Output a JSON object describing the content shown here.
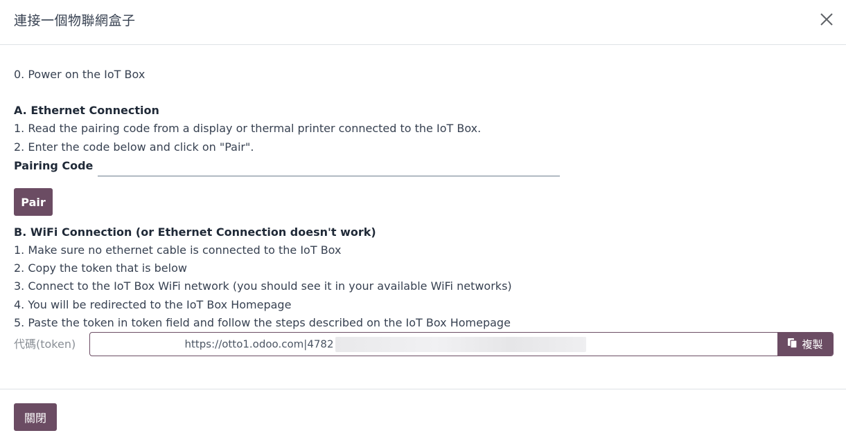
{
  "dialog": {
    "title": "連接一個物聯網盒子",
    "close_icon": "close-icon"
  },
  "content": {
    "step0": "0. Power on the IoT Box",
    "section_a": {
      "heading": "A. Ethernet Connection",
      "step1": "1. Read the pairing code from a display or thermal printer connected to the IoT Box.",
      "step2": "2. Enter the code below and click on \"Pair\".",
      "pairing_label": "Pairing Code",
      "pairing_value": "",
      "pairing_placeholder": "",
      "pair_button": "Pair"
    },
    "section_b": {
      "heading": "B. WiFi Connection (or Ethernet Connection doesn't work)",
      "step1": "1. Make sure no ethernet cable is connected to the IoT Box",
      "step2": "2. Copy the token that is below",
      "step3": "3. Connect to the IoT Box WiFi network (you should see it in your available WiFi networks)",
      "step4": "4. You will be redirected to the IoT Box Homepage",
      "step5": "5. Paste the token in token field and follow the steps described on the IoT Box Homepage",
      "token_label": "代碼(token)",
      "token_value": "https://otto1.odoo.com|4782",
      "copy_button": "複製",
      "copy_icon": "copy-icon"
    }
  },
  "footer": {
    "close_button": "關閉"
  },
  "colors": {
    "primary": "#6b4c63",
    "text": "#374151",
    "muted": "#8a8f96",
    "border": "#dee2e6"
  }
}
